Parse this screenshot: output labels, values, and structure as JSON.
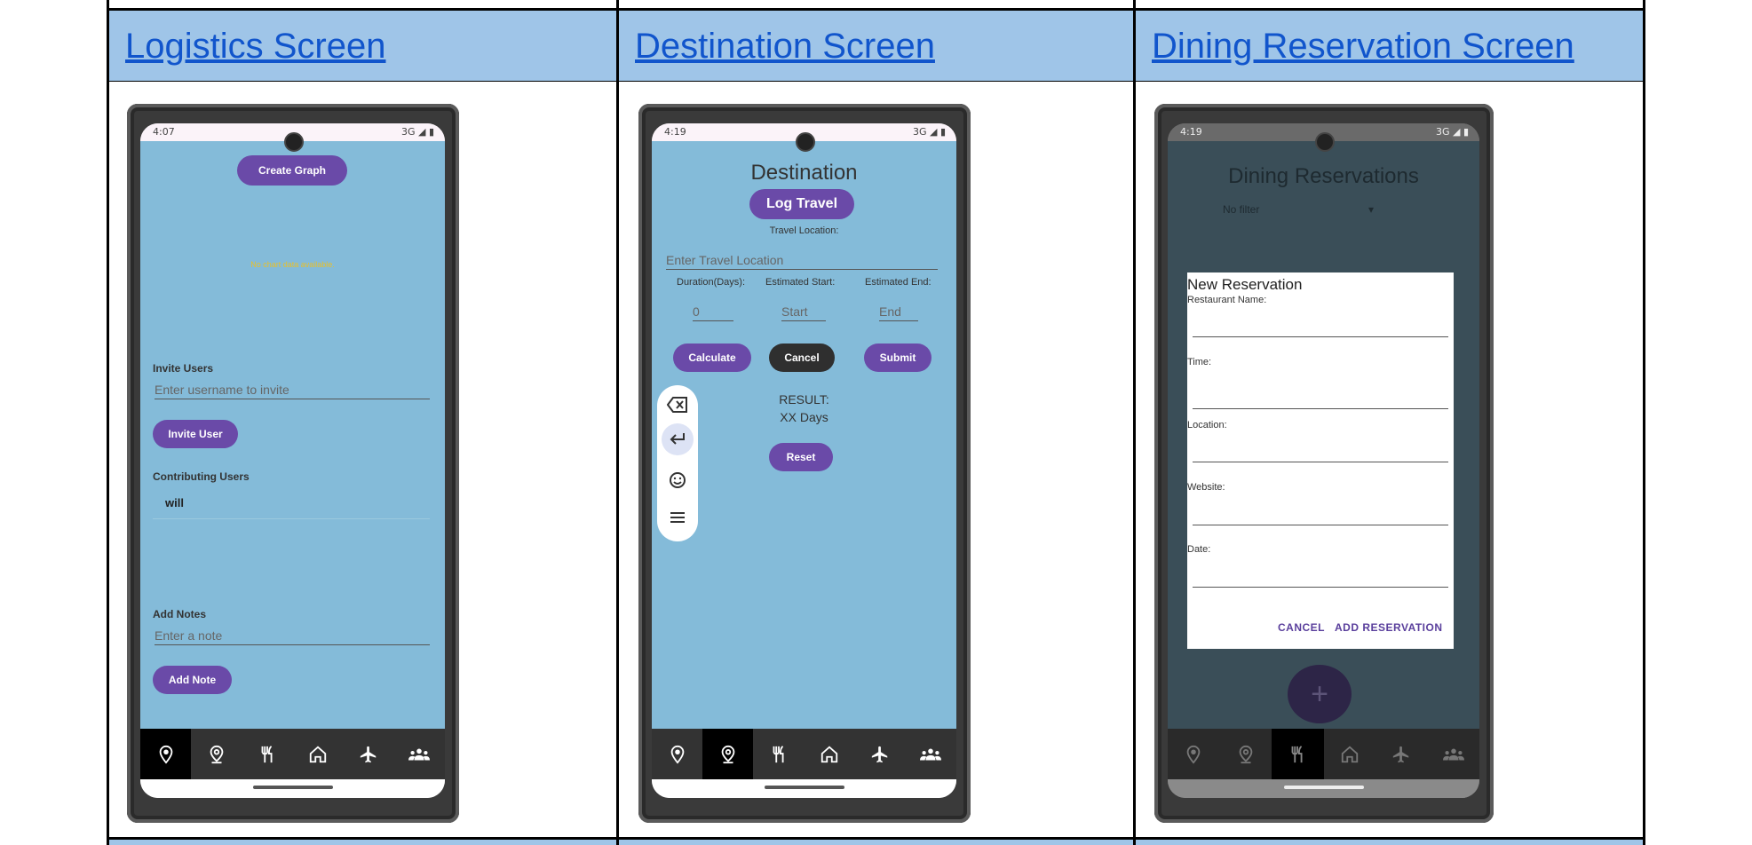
{
  "columns": [
    {
      "header": "Logistics Screen"
    },
    {
      "header": "Destination Screen"
    },
    {
      "header": "Dining Reservation Screen"
    }
  ],
  "logistics": {
    "status_time": "4:07",
    "status_right": "3G ◢ ▮",
    "create_graph": "Create Graph",
    "no_chart": "No chart data available.",
    "invite_users_label": "Invite Users",
    "invite_placeholder": "Enter username to invite",
    "invite_button": "Invite User",
    "contributing_label": "Contributing Users",
    "contributing_user": "will",
    "add_notes_label": "Add Notes",
    "note_placeholder": "Enter a note",
    "add_note_button": "Add Note",
    "active_nav": 0
  },
  "destination": {
    "status_time": "4:19",
    "status_right": "3G ◢ ▮",
    "title": "Destination",
    "log_travel": "Log Travel",
    "travel_location_label": "Travel Location:",
    "travel_location_placeholder": "Enter Travel Location",
    "duration_label": "Duration(Days):",
    "start_label": "Estimated Start:",
    "end_label": "Estimated End:",
    "duration_placeholder": "0",
    "start_placeholder": "Start",
    "end_placeholder": "End",
    "calculate": "Calculate",
    "cancel": "Cancel",
    "submit": "Submit",
    "result_label": "RESULT:",
    "result_value": "XX Days",
    "reset": "Reset",
    "active_nav": 1
  },
  "dining": {
    "status_time": "4:19",
    "status_right": "3G ◢ ▮",
    "title": "Dining Reservations",
    "filter": "No filter",
    "dialog_title": "New Reservation",
    "restaurant_label": "Restaurant Name:",
    "time_label": "Time:",
    "location_label": "Location:",
    "website_label": "Website:",
    "date_label": "Date:",
    "cancel": "CANCEL",
    "add": "ADD RESERVATION",
    "fab": "+",
    "active_nav": 2
  },
  "nav_icons": [
    "map-pin-outline-icon",
    "location-pin-icon",
    "fork-knife-icon",
    "home-icon",
    "airplane-icon",
    "group-icon"
  ],
  "colors": {
    "header_bg": "#9fc5e8",
    "screen_bg": "#84bbd9",
    "accent": "#6a4aa8",
    "link": "#1155cc"
  }
}
